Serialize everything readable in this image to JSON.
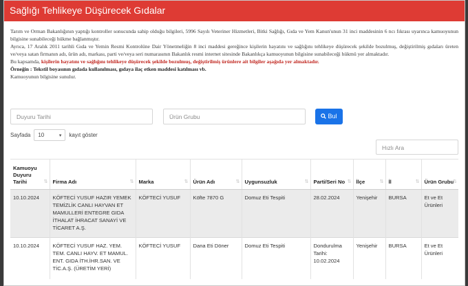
{
  "header": {
    "title": "Sağlığı Tehlikeye Düşürecek Gıdalar"
  },
  "notice": {
    "p1": "Tarım ve Orman Bakanlığının yaptığı kontroller sonucunda sahip olduğu bilgileri, 5996 Sayılı Veteriner Hizmetleri, Bitki Sağlığı, Gıda ve Yem Kanun'unun 31 inci maddesinin 6 ncı fıkrası uyarınca kamuoyunun bilgisine sunabileceği hükme bağlanmıştır.",
    "p2": "Ayrıca, 17 Aralık 2011 tarihli Gıda ve Yemin Resmi Kontrolüne Dair Yönetmeliğin 8 inci maddesi gereğince kişilerin hayatını ve sağlığını tehlikeye düşürecek şekilde bozulmuş, değiştirilmiş gıdaları üreten ve/veya satan firmanın adı, ürün adı, markası, parti ve/veya seri numarasının Bakanlık resmi internet sitesinde Bakanlıkça kamuoyunun bilgisine sunabileceği hükmü yer almaktadır.",
    "p3_prefix": "Bu kapsamda, ",
    "p3_red": "kişilerin hayatını ve sağlığını tehlikeye düşürecek şekilde bozulmuş, değiştirilmiş ürünlere ait bilgiler aşağıda yer almaktadır.",
    "p4": "Örneğin : Tekstil boyasının gıdada kullanılması, gıdaya ilaç etken maddesi katılması vb.",
    "p5": "Kamuoyunun bilgisine sunulur."
  },
  "filters": {
    "date_placeholder": "Duyuru Tarihi",
    "group_placeholder": "Ürün Grubu",
    "search_label": "Bul"
  },
  "paging": {
    "prefix": "Sayfada",
    "value": "10",
    "suffix": "kayıt göster"
  },
  "quick_search": {
    "placeholder": "Hızlı Ara"
  },
  "table": {
    "headers": [
      "Kamuoyu Duyuru Tarihi",
      "Firma Adı",
      "Marka",
      "Ürün Adı",
      "Uygunsuzluk",
      "Parti/Seri No",
      "İlçe",
      "İl",
      "Ürün Grubu"
    ],
    "rows": [
      [
        "10.10.2024",
        "KÖFTECİ YUSUF HAZIR YEMEK TEMİZLİK CANLI HAYVAN ET MAMULLERİ ENTEGRE GIDA İTHALAT İHRACAT SANAYİ VE TİCARET A.Ş.",
        "KÖFTECİ YUSUF",
        "Köfte 7870 G",
        "Domuz Eti Tespiti",
        "28.02.2024",
        "Yenişehir",
        "BURSA",
        "Et ve Et Ürünleri"
      ],
      [
        "10.10.2024",
        "KÖFTECİ YUSUF HAZ. YEM. TEM. CANLI HAYV. ET MAMUL. ENT. GIDA İTH.İHR.SAN. VE TİC.A.Ş. (ÜRETİM YERİ)",
        "KÖFTECİ YUSUF",
        "Dana Eti Döner",
        "Domuz Eti Tespiti",
        "Dondurulma Tarihi: 10.02.2024",
        "Yenişehir",
        "BURSA",
        "Et ve Et Ürünleri"
      ]
    ]
  },
  "colors": {
    "header_bg": "#de3b34",
    "button_bg": "#1a73e8",
    "warning_text": "#c0261f"
  }
}
